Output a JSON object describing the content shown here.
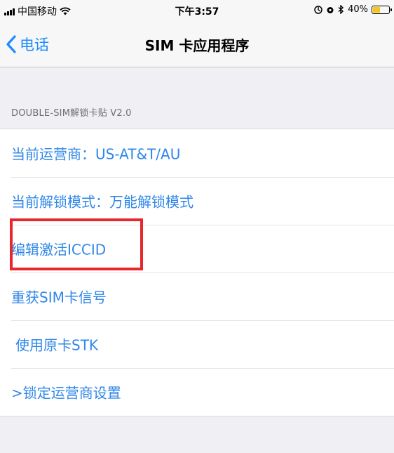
{
  "status_bar": {
    "carrier": "中国移动",
    "time": "下午3:57",
    "battery_percent": "40%",
    "battery_level": 0.4,
    "icons": [
      "signal-icon",
      "wifi-icon",
      "location-icon",
      "alarm-icon",
      "bluetooth-icon",
      "battery-icon"
    ]
  },
  "nav": {
    "back_label": "电话",
    "title": "SIM 卡应用程序"
  },
  "section": {
    "header": "DOUBLE-SIM解锁卡贴 V2.0"
  },
  "list": {
    "items": [
      {
        "label": "当前运营商：US-AT&T/AU"
      },
      {
        "label": "当前解锁模式：万能解锁模式"
      },
      {
        "label": "编辑激活ICCID",
        "highlighted": true
      },
      {
        "label": "重获SIM卡信号"
      },
      {
        "label": "使用原卡STK"
      },
      {
        "label": ">锁定运营商设置"
      }
    ]
  },
  "colors": {
    "accent": "#2f87e8",
    "highlight": "#e8262b",
    "battery": "#f5c518",
    "background": "#efeff4"
  }
}
